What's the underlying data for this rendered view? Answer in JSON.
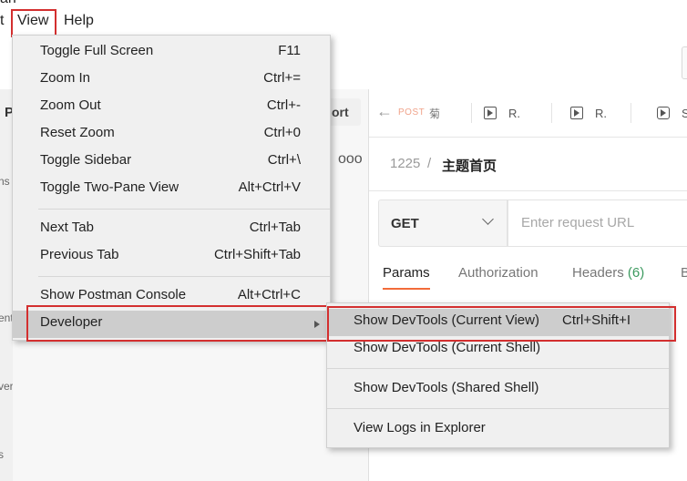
{
  "menubar": {
    "partial_title": "an",
    "partial_item": "t",
    "view": "View",
    "help": "Help"
  },
  "sidebar": {
    "header_partial": "P",
    "import_partial": "ort",
    "more_glyph": "ooo",
    "strip_texts": [
      "ns",
      "ent",
      "vers",
      "s"
    ]
  },
  "tabs": {
    "back_glyph": "←",
    "first_tab_method": "POST",
    "first_tab_char": "菊",
    "second_tab": "R.",
    "third_tab": "R.",
    "fourth_tab": "S"
  },
  "request": {
    "breadcrumb_number": "1225",
    "breadcrumb_separator": "/",
    "breadcrumb_title": "主题首页",
    "method": "GET",
    "url_placeholder": "Enter request URL",
    "tabs": {
      "params": "Params",
      "authorization": "Authorization",
      "headers": "Headers",
      "headers_count": "(6)",
      "partial_next": "B"
    }
  },
  "view_menu": {
    "items": [
      {
        "label": "Toggle Full Screen",
        "shortcut": "F11"
      },
      {
        "label": "Zoom In",
        "shortcut": "Ctrl+="
      },
      {
        "label": "Zoom Out",
        "shortcut": "Ctrl+-"
      },
      {
        "label": "Reset Zoom",
        "shortcut": "Ctrl+0"
      },
      {
        "label": "Toggle Sidebar",
        "shortcut": "Ctrl+\\"
      },
      {
        "label": "Toggle Two-Pane View",
        "shortcut": "Alt+Ctrl+V"
      },
      {
        "label": "Next Tab",
        "shortcut": "Ctrl+Tab"
      },
      {
        "label": "Previous Tab",
        "shortcut": "Ctrl+Shift+Tab"
      },
      {
        "label": "Show Postman Console",
        "shortcut": "Alt+Ctrl+C"
      },
      {
        "label": "Developer",
        "shortcut": ""
      }
    ]
  },
  "developer_submenu": {
    "items": [
      {
        "label": "Show DevTools (Current View)",
        "shortcut": "Ctrl+Shift+I"
      },
      {
        "label": "Show DevTools (Current Shell)",
        "shortcut": ""
      },
      {
        "label": "Show DevTools (Shared Shell)",
        "shortcut": ""
      },
      {
        "label": "View Logs in Explorer",
        "shortcut": ""
      }
    ]
  },
  "colors": {
    "highlight_border": "#d32f2f",
    "accent": "#f26b3a",
    "success": "#3c9a5f",
    "menu_bg": "#f0f0f0",
    "menu_hover": "#cdcdcd"
  }
}
